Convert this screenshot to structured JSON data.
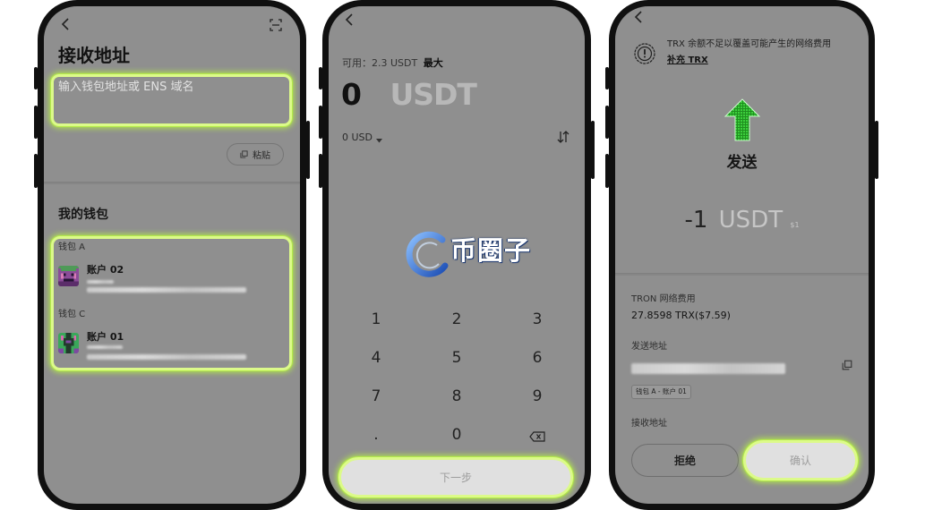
{
  "colors": {
    "screen_overlay": "#8f8f8f",
    "highlight": "#dcfa8a",
    "highlight_glow": "#b5ec4a",
    "send_arrow": "#3ccf3c"
  },
  "receive_screen": {
    "back_icon": "back-icon",
    "scan_icon": "scan-icon",
    "title": "接收地址",
    "address_input": {
      "placeholder": "输入钱包地址或 ENS 域名"
    },
    "paste_button": {
      "icon": "copy-icon",
      "label": "粘贴"
    },
    "my_wallets": {
      "title": "我的钱包",
      "groups": [
        {
          "name": "钱包 A",
          "accounts": [
            {
              "name": "账户 02"
            }
          ]
        },
        {
          "name": "钱包 C",
          "accounts": [
            {
              "name": "账户 01"
            }
          ]
        }
      ]
    }
  },
  "amount_screen": {
    "back_icon": "back-icon",
    "available": {
      "label": "可用：2.3 USDT",
      "max_label": "最大"
    },
    "amount": {
      "value": "0",
      "currency": "USDT"
    },
    "fiat": {
      "value": "0 USD",
      "icon": "chevron-down-icon"
    },
    "swap_icon": "swap-icon",
    "keys": [
      "1",
      "2",
      "3",
      "4",
      "5",
      "6",
      "7",
      "8",
      "9",
      ".",
      "0"
    ],
    "backspace_icon": "backspace-icon",
    "next_button": "下一步",
    "watermark": "币圈子"
  },
  "confirm_screen": {
    "back_icon": "back-icon",
    "warning": {
      "icon": "warning-icon",
      "text": "TRX 余额不足以覆盖可能产生的网络费用",
      "link": "补充 TRX"
    },
    "action": {
      "icon": "arrow-up-icon",
      "label": "发送"
    },
    "amount": {
      "value": "-1",
      "currency": "USDT",
      "fiat": "$1"
    },
    "network_fee": {
      "label": "TRON 网络费用",
      "value": "27.8598 TRX($7.59)"
    },
    "from": {
      "label": "发送地址",
      "copy_icon": "copy-icon",
      "wallet_badge": "钱包 A - 账户 01"
    },
    "to": {
      "label": "接收地址"
    },
    "reject_button": "拒绝",
    "confirm_button": "确认"
  }
}
